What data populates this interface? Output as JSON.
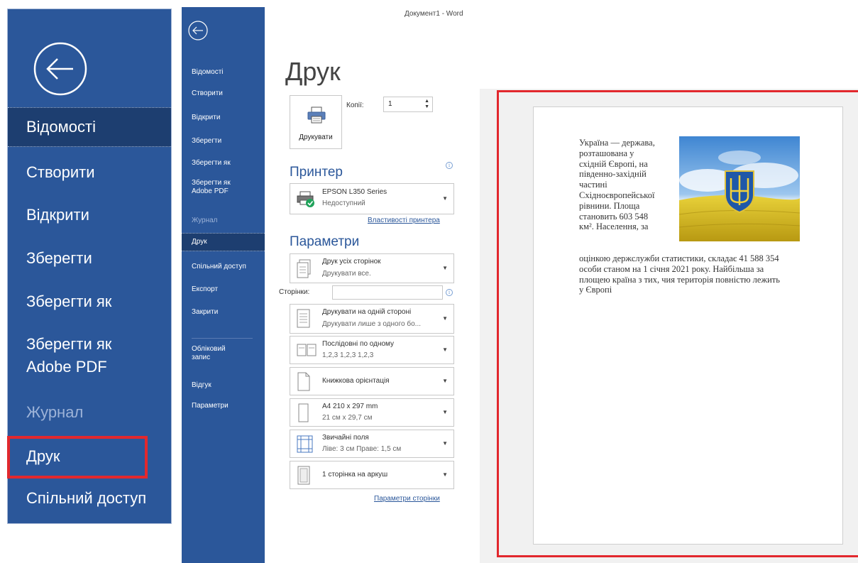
{
  "window": {
    "title": "Документ1 - Word"
  },
  "zoom_panel": {
    "items": [
      {
        "label": "Відомості",
        "state": "active"
      },
      {
        "label": "Створити",
        "state": "normal"
      },
      {
        "label": "Відкрити",
        "state": "normal"
      },
      {
        "label": "Зберегти",
        "state": "normal"
      },
      {
        "label": "Зберегти як",
        "state": "normal"
      },
      {
        "label_line1": "Зберегти як",
        "label_line2": "Adobe PDF",
        "state": "normal"
      },
      {
        "label": "Журнал",
        "state": "disabled"
      },
      {
        "label": "Друк",
        "state": "highlighted"
      },
      {
        "label": "Спільний доступ",
        "state": "normal"
      }
    ]
  },
  "nav": {
    "items": [
      {
        "label": "Відомості"
      },
      {
        "label": "Створити"
      },
      {
        "label": "Відкрити"
      },
      {
        "label": "Зберегти"
      },
      {
        "label": "Зберегти як"
      },
      {
        "label_line1": "Зберегти як",
        "label_line2": "Adobe PDF"
      },
      {
        "label": "Журнал",
        "state": "disabled"
      },
      {
        "label": "Друк",
        "state": "active"
      },
      {
        "label": "Спільний доступ"
      },
      {
        "label": "Експорт"
      },
      {
        "label": "Закрити"
      },
      {
        "label_line1": "Обліковий",
        "label_line2": "запис"
      },
      {
        "label": "Відгук"
      },
      {
        "label": "Параметри"
      }
    ]
  },
  "print": {
    "title": "Друк",
    "print_button": "Друкувати",
    "copies_label": "Копії:",
    "copies_value": "1",
    "printer_heading": "Принтер",
    "printer_name": "EPSON L350 Series",
    "printer_status": "Недоступний",
    "printer_properties_link": "Властивості принтера",
    "settings_heading": "Параметри",
    "pages_label": "Сторінки:",
    "pages_value": "",
    "page_setup_link": "Параметри сторінки",
    "settings": [
      {
        "line1": "Друк усіх сторінок",
        "line2": "Друкувати все."
      },
      {
        "line1": "Друкувати на одній стороні",
        "line2": "Друкувати лише з одного бо..."
      },
      {
        "line1": "Послідовні по одному",
        "line2": "1,2,3   1,2,3   1,2,3"
      },
      {
        "line1": "Книжкова орієнтація",
        "line2": ""
      },
      {
        "line1": "A4 210 x 297 mm",
        "line2": "21 см x 29,7 см"
      },
      {
        "line1": "Звичайні поля",
        "line2": "Ліве:  3 см    Праве:  1,5 см"
      },
      {
        "line1": "1 сторінка на аркуш",
        "line2": ""
      }
    ]
  },
  "preview": {
    "narrow_lines": [
      "Україна — держава,",
      "розташована у",
      "східній Європі, на",
      "південно-західній",
      "частині",
      "Східноєвропейської",
      "рівнини. Площа",
      "становить 603 548",
      "км². Населення, за"
    ],
    "wide_lines": [
      "оцінкою держслужби статистики, складає 41 588 354",
      "особи станом на 1 січня 2021 року. Найбільша за",
      "площею країна з тих, чия територія повністю лежить",
      "у Європі"
    ]
  },
  "colors": {
    "accent": "#2b579a",
    "nav_active": "#1d3e70",
    "highlight": "#e2282d"
  }
}
